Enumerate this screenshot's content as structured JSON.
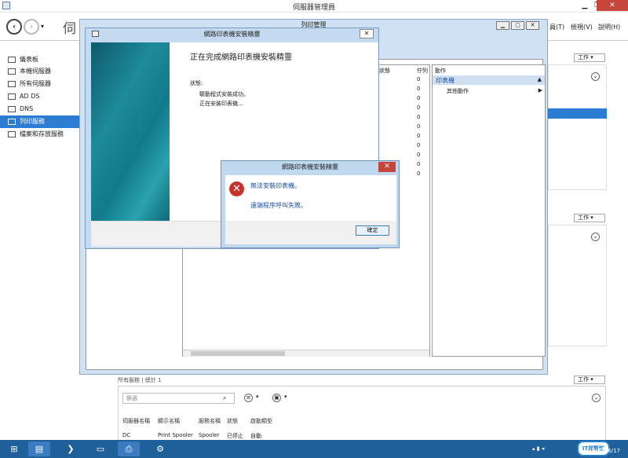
{
  "server_manager": {
    "title": "伺服器管理員",
    "breadcrumb": "伺",
    "menu": {
      "manage": "員(T)",
      "view": "檢視(V)",
      "help": "說明(H)"
    },
    "sidebar": [
      {
        "label": "儀表板"
      },
      {
        "label": "本機伺服器"
      },
      {
        "label": "所有伺服器"
      },
      {
        "label": "AD DS"
      },
      {
        "label": "DNS"
      },
      {
        "label": "列印服務",
        "selected": true
      },
      {
        "label": "檔案和存放服務"
      }
    ],
    "tasks_label": "工作",
    "services": {
      "title": "所有服務 | 總計 1",
      "filter_placeholder": "篩選",
      "columns": [
        "伺服器名稱",
        "顯示名稱",
        "服務名稱",
        "狀態",
        "啟動類型"
      ],
      "row": [
        "DC",
        "Print Spooler",
        "Spooler",
        "已停止",
        "自動"
      ]
    }
  },
  "print_management": {
    "title": "列印管理",
    "columns": {
      "status": "狀態",
      "jobs": "佇列"
    },
    "job_counts": [
      "0",
      "0",
      "0",
      "0",
      "0",
      "0",
      "0",
      "0",
      "0",
      "0",
      "0"
    ],
    "actions_header": "動作",
    "actions_group": "印表機",
    "actions_more": "其他動作"
  },
  "wizard": {
    "title": "網路印表機安裝精靈",
    "heading": "正在完成網路印表機安裝精靈",
    "status_label": "狀態:",
    "line1": "驅動程式安裝成功。",
    "line2": "正在安裝印表機..."
  },
  "error_dialog": {
    "title": "網路印表機安裝精靈",
    "message1": "無法安裝印表機。",
    "message2": "遠端程序呼叫失敗。",
    "ok": "確定"
  },
  "taskbar": {
    "date": "2014/6/17"
  },
  "watermark": "IT邦幫忙",
  "colors": {
    "selected": "#2c7cd3",
    "taskbar": "#1f5f9a",
    "error": "#c8322a",
    "link_text": "#1a4fa0"
  }
}
